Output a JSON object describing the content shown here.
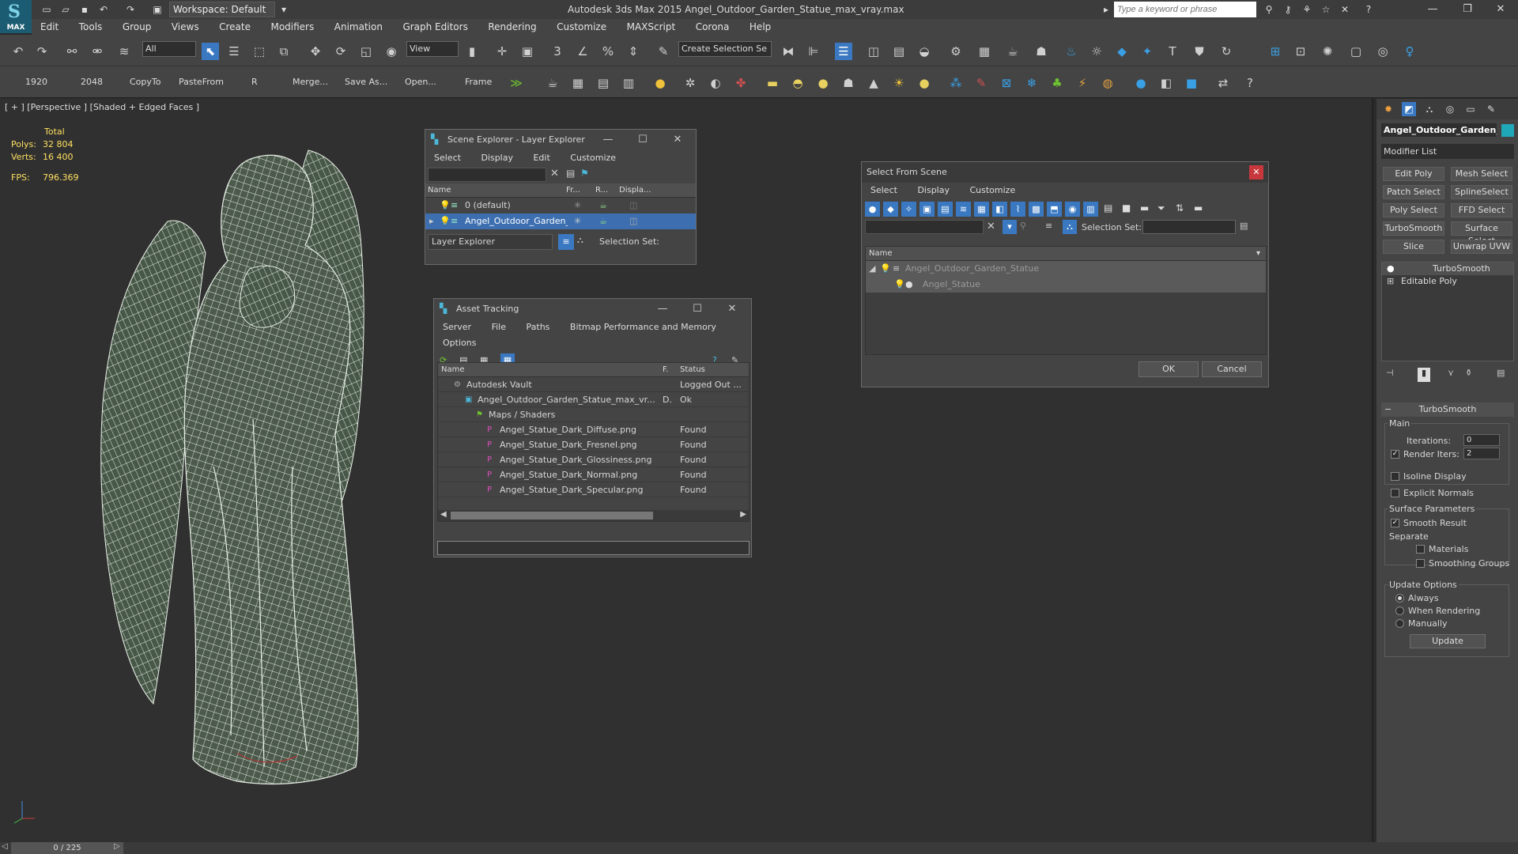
{
  "app": {
    "logo_label": "MAX",
    "window_title": "Autodesk 3ds Max 2015    Angel_Outdoor_Garden_Statue_max_vray.max",
    "workspace": "Workspace: Default",
    "search_placeholder": "Type a keyword or phrase"
  },
  "menu": [
    "Edit",
    "Tools",
    "Group",
    "Views",
    "Create",
    "Modifiers",
    "Animation",
    "Graph Editors",
    "Rendering",
    "Customize",
    "MAXScript",
    "Corona",
    "Help"
  ],
  "toolbar": {
    "selection_filter": "All",
    "ref_coord": "View",
    "named_selection": "Create Selection Se"
  },
  "toolbar2": {
    "items": [
      "1920",
      "2048",
      "CopyTo",
      "PasteFrom",
      "R",
      "Merge...",
      "Save As...",
      "Open...",
      "Frame"
    ]
  },
  "viewport": {
    "label": "[ + ] [Perspective ] [Shaded + Edged Faces ]",
    "stats_header": "Total",
    "polys_label": "Polys:",
    "polys_value": "32 804",
    "verts_label": "Verts:",
    "verts_value": "16 400",
    "fps_label": "FPS:",
    "fps_value": "796.369"
  },
  "scene_explorer": {
    "title": "Scene Explorer - Layer Explorer",
    "menu": [
      "Select",
      "Display",
      "Edit",
      "Customize"
    ],
    "columns": [
      "Name",
      "Fr...",
      "R...",
      "Displa..."
    ],
    "rows": [
      "0 (default)",
      "Angel_Outdoor_Garden_Statue..."
    ],
    "footer_mode": "Layer Explorer",
    "footer_selset": "Selection Set:"
  },
  "asset_tracking": {
    "title": "Asset Tracking",
    "menu": [
      "Server",
      "File",
      "Paths",
      "Bitmap Performance and Memory",
      "Options"
    ],
    "columns": [
      "Name",
      "F.",
      "Status"
    ],
    "rows": [
      {
        "name": "Autodesk Vault",
        "f": "",
        "status": "Logged Out ..."
      },
      {
        "name": "Angel_Outdoor_Garden_Statue_max_vr...",
        "f": "D.",
        "status": "Ok"
      },
      {
        "name": "Maps / Shaders",
        "f": "",
        "status": ""
      },
      {
        "name": "Angel_Statue_Dark_Diffuse.png",
        "f": "",
        "status": "Found"
      },
      {
        "name": "Angel_Statue_Dark_Fresnel.png",
        "f": "",
        "status": "Found"
      },
      {
        "name": "Angel_Statue_Dark_Glossiness.png",
        "f": "",
        "status": "Found"
      },
      {
        "name": "Angel_Statue_Dark_Normal.png",
        "f": "",
        "status": "Found"
      },
      {
        "name": "Angel_Statue_Dark_Specular.png",
        "f": "",
        "status": "Found"
      }
    ]
  },
  "select_from_scene": {
    "title": "Select From Scene",
    "menu": [
      "Select",
      "Display",
      "Customize"
    ],
    "selset_label": "Selection Set:",
    "column": "Name",
    "rows": [
      "Angel_Outdoor_Garden_Statue",
      "Angel_Statue"
    ],
    "ok": "OK",
    "cancel": "Cancel"
  },
  "command_panel": {
    "object_name": "Angel_Outdoor_Garden_",
    "modifier_list": "Modifier List",
    "mod_buttons": [
      "Edit Poly",
      "Mesh Select",
      "Patch Select",
      "SplineSelect",
      "Poly Select",
      "FFD Select",
      "TurboSmooth",
      "Surface Select",
      "Slice",
      "Unwrap UVW"
    ],
    "stack": [
      "TurboSmooth",
      "Editable Poly"
    ],
    "rollout": "TurboSmooth",
    "main_label": "Main",
    "iterations_label": "Iterations:",
    "iterations_value": "0",
    "render_iters_label": "Render Iters:",
    "render_iters_value": "2",
    "isoline": "Isoline Display",
    "explicit_normals": "Explicit Normals",
    "surface_params": "Surface Parameters",
    "smooth_result": "Smooth Result",
    "separate": "Separate",
    "materials": "Materials",
    "smoothing_groups": "Smoothing Groups",
    "update_options": "Update Options",
    "always": "Always",
    "when_rendering": "When Rendering",
    "manually": "Manually",
    "update_button": "Update"
  },
  "status": {
    "time": "0 / 225"
  },
  "colors": {
    "accent": "#3a79c2",
    "wire": "#e8f0e6",
    "stats": "#ffe060"
  }
}
